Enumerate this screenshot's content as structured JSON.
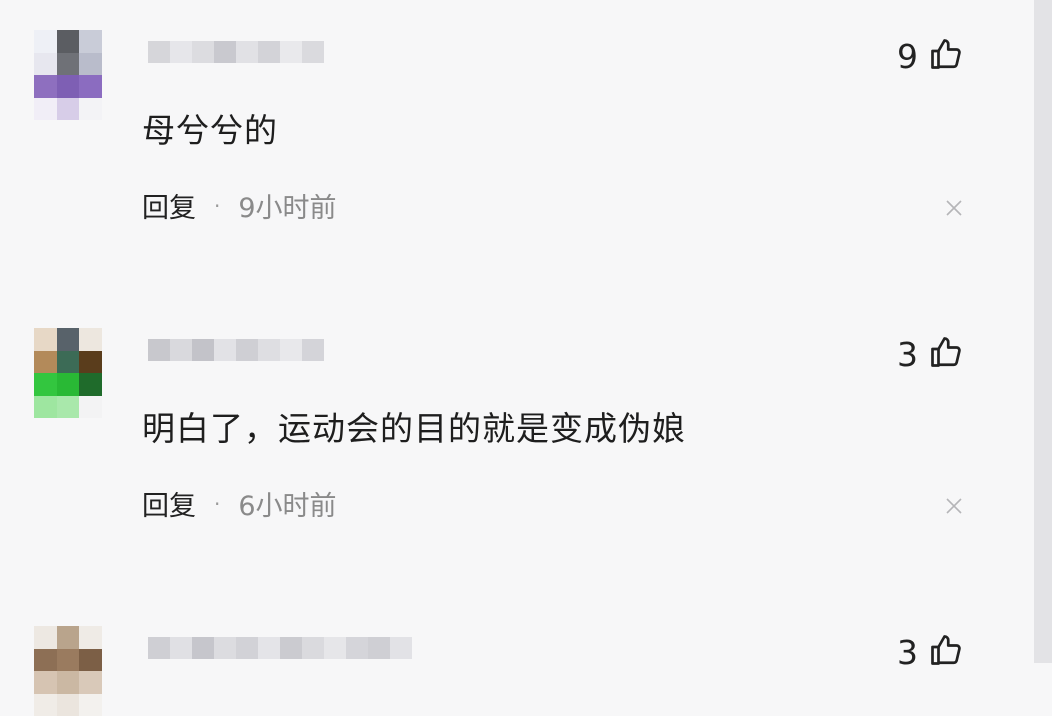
{
  "comments": [
    {
      "username": "",
      "content": "母兮兮的",
      "reply_label": "回复",
      "separator": "·",
      "time": "9小时前",
      "likes": "9"
    },
    {
      "username": "",
      "content": "明白了，运动会的目的就是变成伪娘",
      "reply_label": "回复",
      "separator": "·",
      "time": "6小时前",
      "likes": "3"
    },
    {
      "username": "",
      "content": "",
      "reply_label": "",
      "separator": "",
      "time": "",
      "likes": "3"
    }
  ],
  "icons": {
    "like": "thumbs-up-icon",
    "close": "close-icon"
  },
  "colors": {
    "background": "#f7f7f8",
    "text": "#1e1e1e",
    "secondary": "#8a8a8a"
  }
}
